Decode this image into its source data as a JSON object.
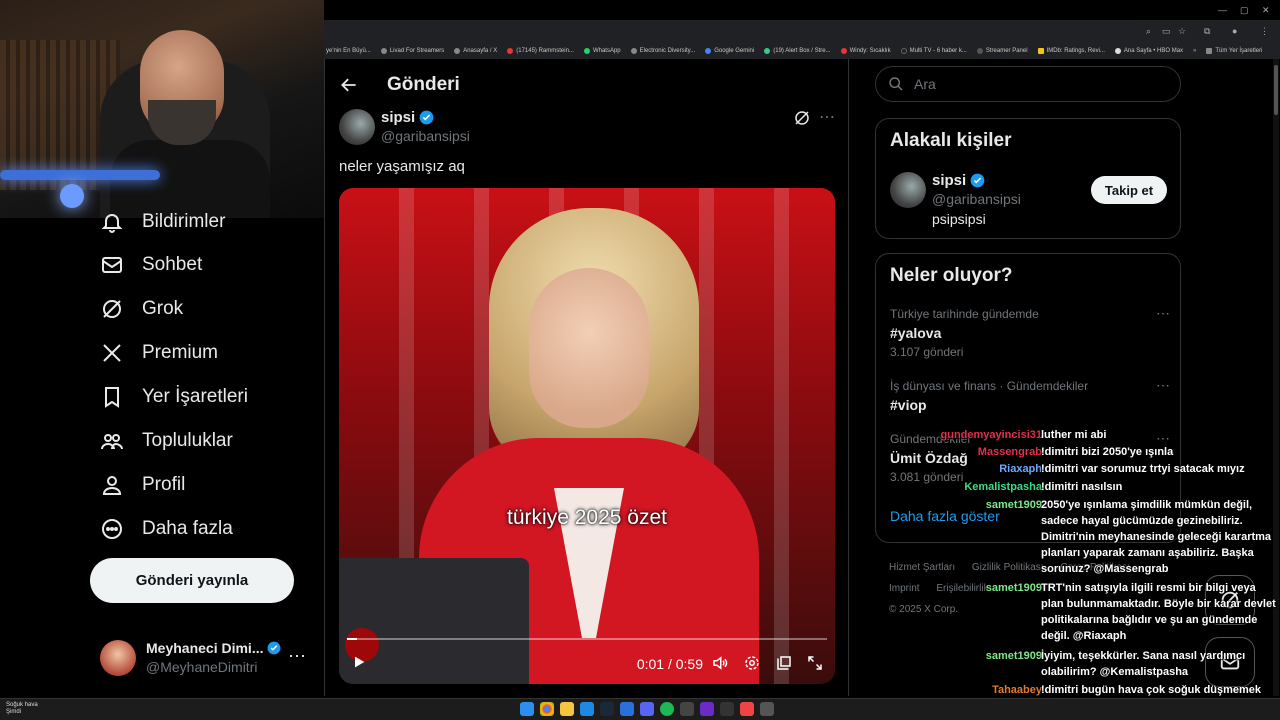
{
  "nav": {
    "items": [
      {
        "label": "Bildirimler",
        "icon": "bell-icon"
      },
      {
        "label": "Sohbet",
        "icon": "mail-icon"
      },
      {
        "label": "Grok",
        "icon": "grok-icon"
      },
      {
        "label": "Premium",
        "icon": "x-logo-icon"
      },
      {
        "label": "Yer İşaretleri",
        "icon": "bookmark-icon"
      },
      {
        "label": "Topluluklar",
        "icon": "people-icon"
      },
      {
        "label": "Profil",
        "icon": "person-icon"
      },
      {
        "label": "Daha fazla",
        "icon": "more-circle-icon"
      }
    ],
    "post_button": "Gönderi yayınla",
    "profile": {
      "name": "Meyhaneci Dimi...",
      "handle": "@MeyhaneDimitri"
    }
  },
  "bookmarks": [
    "ye'nin En Büyü...",
    "Livad For Streamers",
    "Anasayfa / X",
    "(17145) Rammstein...",
    "WhatsApp",
    "Electronic Diversity...",
    "Google Gemini",
    "(19) Alert Box / Stre...",
    "Windy: Sıcaklık",
    "Multi TV - 6 haber k...",
    "Streamer Panel",
    "IMDb: Ratings, Revi...",
    "Ana Sayfa • HBO Max",
    "Tüm Yer İşaretleri"
  ],
  "post": {
    "header_title": "Gönderi",
    "author_name": "sipsi",
    "author_handle": "@garibansipsi",
    "text": "neler yaşamışız aq",
    "video": {
      "caption": "türkiye 2025 özet",
      "current_time": "0:01",
      "duration": "0:59",
      "progress": 0.02
    }
  },
  "sidebar": {
    "search_placeholder": "Ara",
    "related": {
      "title": "Alakalı kişiler",
      "name": "sipsi",
      "handle": "@garibansipsi",
      "bio": "psipsipsi",
      "follow": "Takip et"
    },
    "trends": {
      "title": "Neler oluyor?",
      "items": [
        {
          "context": "Türkiye tarihinde gündemde",
          "topic": "#yalova",
          "count": "3.107 gönderi"
        },
        {
          "context": "İş dünyası ve finans · Gündemdekiler",
          "topic": "#viop",
          "count": ""
        },
        {
          "context": "Gündemdekiler",
          "topic": "Ümit Özdağ",
          "count": "3.081 gönderi"
        }
      ],
      "show_more": "Daha fazla göster"
    },
    "footer": [
      "Hizmet Şartları",
      "Gizlilik Politikası",
      "Çerez Politikası",
      "Imprint",
      "Erişilebilirlik",
      "© 2025 X Corp."
    ]
  },
  "chat": [
    {
      "user": "gundemyayincisi31",
      "text": "luther mi abi",
      "color": "#e0304a"
    },
    {
      "user": "Massengrab",
      "text": "!dimitri bizi 2050'ye ışınla",
      "color": "#e0304a"
    },
    {
      "user": "Riaxaph",
      "text": "!dimitri var sorumuz trtyi satacak mıyız",
      "color": "#6ea8ff"
    },
    {
      "user": "Kemalistpasha",
      "text": "!dimitri nasılsın",
      "color": "#3ddc84"
    },
    {
      "user": "samet1909",
      "text": "2050'ye ışınlama şimdilik mümkün değil, sadece hayal gücümüzde gezinebiliriz. Dimitri'nin meyhanesinde geleceği karartma planları yaparak zamanı aşabiliriz. Başka sorunuz? @Massengrab",
      "color": "#7ee787"
    },
    {
      "user": "samet1909",
      "text": "TRT'nin satışıyla ilgili resmi bir bilgi veya plan bulunmamaktadır. Böyle bir karar devlet politikalarına bağlıdır ve şu an gündemde değil. @Riaxaph",
      "color": "#7ee787"
    },
    {
      "user": "samet1909",
      "text": "İyiyim, teşekkürler. Sana nasıl yardımcı olabilirim? @Kemalistpasha",
      "color": "#7ee787"
    },
    {
      "user": "Tahaabey",
      "text": "!dimitri bugün hava çok soğuk düşmemek için ne giymeliyi",
      "color": "#e07a30"
    }
  ],
  "taskbar": {
    "weather_title": "Soğuk hava",
    "weather_sub": "Şimdi"
  },
  "colors": {
    "accent": "#1d9bf0",
    "bg": "#000000",
    "border": "#2f3336",
    "muted": "#71767b"
  }
}
